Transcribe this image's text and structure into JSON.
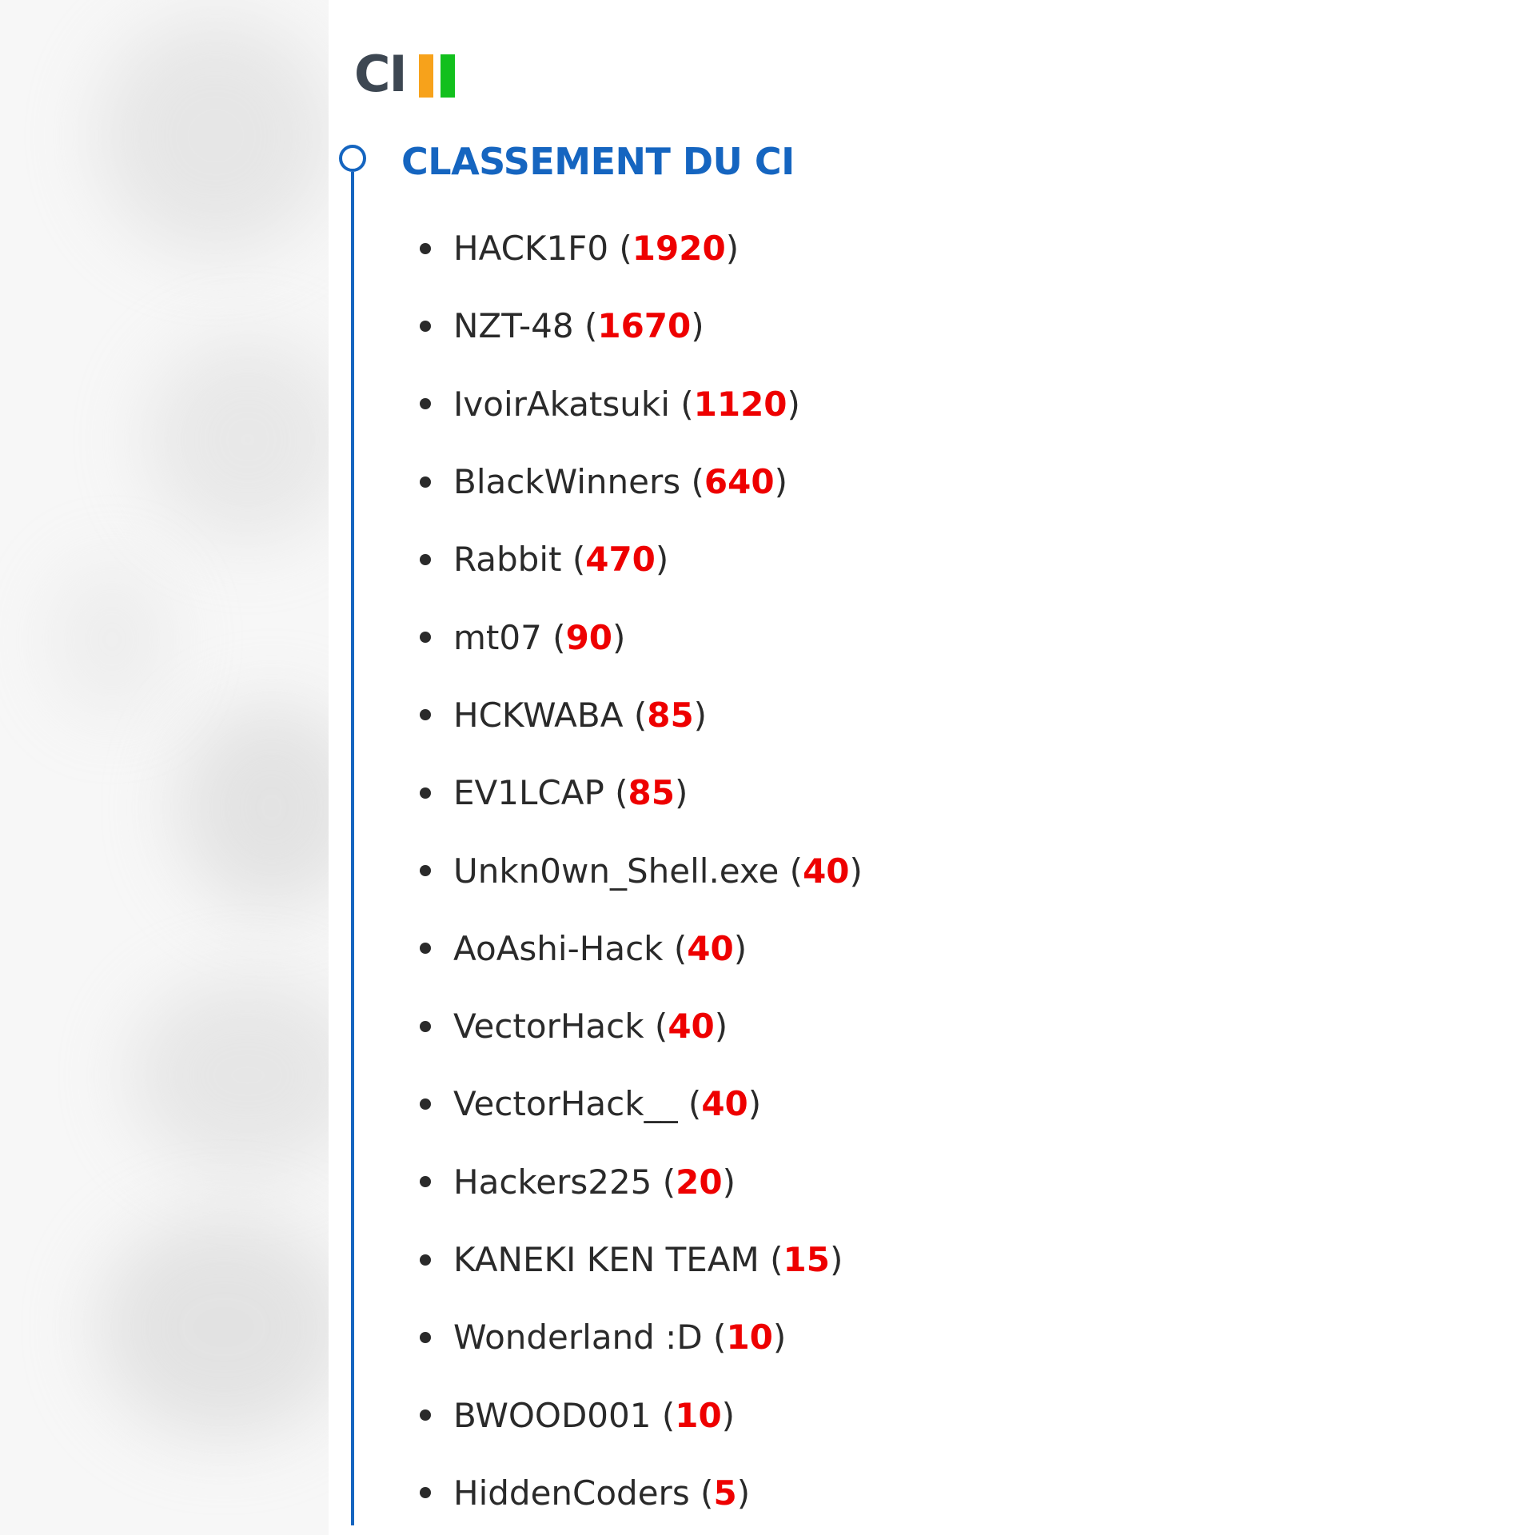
{
  "logo": {
    "text": "CI",
    "flag_colors": [
      "#f7a21b",
      "#12c01d"
    ]
  },
  "colors": {
    "accent": "#1565c0",
    "score": "#ee0000",
    "text": "#2a2a2a"
  },
  "ranking": {
    "title": "CLASSEMENT DU CI",
    "items": [
      {
        "name": "HACK1F0",
        "score": "1920"
      },
      {
        "name": "NZT-48",
        "score": "1670"
      },
      {
        "name": "IvoirAkatsuki",
        "score": "1120"
      },
      {
        "name": "BlackWinners",
        "score": "640"
      },
      {
        "name": "Rabbit",
        "score": "470"
      },
      {
        "name": "mt07",
        "score": "90"
      },
      {
        "name": "HCKWABA",
        "score": "85"
      },
      {
        "name": "EV1LCAP",
        "score": "85"
      },
      {
        "name": "Unkn0wn_Shell.exe",
        "score": "40"
      },
      {
        "name": "AoAshi-Hack",
        "score": "40"
      },
      {
        "name": "VectorHack",
        "score": "40"
      },
      {
        "name": "VectorHack__",
        "score": "40"
      },
      {
        "name": "Hackers225",
        "score": "20"
      },
      {
        "name": "KANEKI KEN TEAM",
        "score": "15"
      },
      {
        "name": "Wonderland :D",
        "score": "10"
      },
      {
        "name": "BWOOD001",
        "score": "10"
      },
      {
        "name": "HiddenCoders",
        "score": "5"
      }
    ]
  }
}
